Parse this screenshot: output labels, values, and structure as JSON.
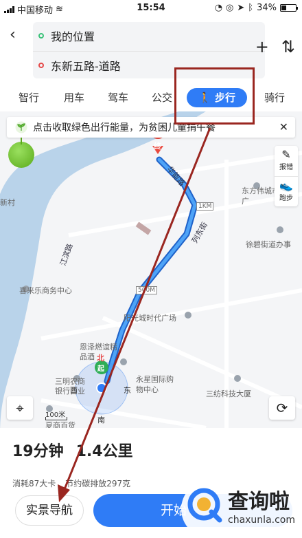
{
  "status_bar": {
    "carrier": "中国移动",
    "time": "15:54",
    "battery": "34%",
    "battery_level": 0.34
  },
  "route": {
    "from": "我的位置",
    "to": "东新五路-道路",
    "back_icon": "back-chevron-icon",
    "add_icon": "plus-icon",
    "swap_icon": "swap-icon"
  },
  "mode_tabs": [
    "智行",
    "用车",
    "驾车",
    "公交",
    "步行",
    "骑行"
  ],
  "active_mode": "步行",
  "banner": {
    "text": "点击收取绿色出行能量，为贫困儿童捐午餐",
    "close": "✕"
  },
  "side_tools": [
    {
      "label": "报错",
      "icon": "report-error-icon"
    },
    {
      "label": "跑步",
      "icon": "running-shoe-icon"
    }
  ],
  "map": {
    "end_marker": "终",
    "start_marker": "起",
    "north_label": "北",
    "distance_labels": [
      "1KM",
      "500M"
    ],
    "road_labels": [
      "华能路",
      "列东街",
      "江滨路"
    ],
    "pois": [
      "东方伟城市广",
      "徐碧街道办事",
      "喜来乐商务中心",
      "阳光城时代广场",
      "恩泽燃谊精品酒",
      "三明农商银行营业",
      "永星国际购物中心",
      "三纺科技大厦",
      "夏商百货",
      "新村"
    ],
    "compass": {
      "west": "西",
      "east": "东",
      "south": "南"
    },
    "scale": "100米"
  },
  "summary": {
    "duration": "19分钟",
    "distance": "1.4公里",
    "calories": "消耗87大卡",
    "carbon": "节约碳排放297克"
  },
  "buttons": {
    "ar_nav": "实景导航",
    "start": "开始"
  },
  "watermark": {
    "title": "查询啦",
    "url": "chaxunla.com"
  },
  "colors": {
    "accent": "#2f7cf6",
    "annotation": "#9a2620",
    "route": "#3b8ef3"
  }
}
